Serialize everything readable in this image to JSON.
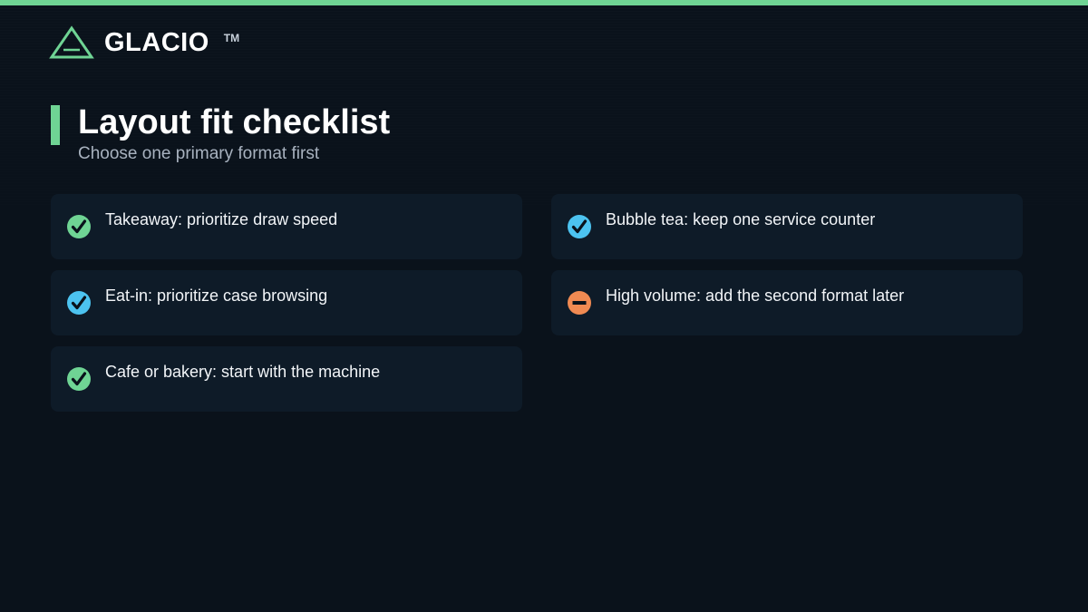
{
  "brand": {
    "name": "GLACIO",
    "trademark": "TM",
    "accent_color": "#6fd494"
  },
  "heading": {
    "title": "Layout fit checklist",
    "subtitle": "Choose one primary format first"
  },
  "checklist": {
    "items": [
      {
        "label": "Takeaway: prioritize draw speed",
        "status": "check",
        "icon": "check-circle-icon",
        "color": "#6fd494"
      },
      {
        "label": "Eat-in: prioritize case browsing",
        "status": "check",
        "icon": "check-circle-icon",
        "color": "#4cc3f0"
      },
      {
        "label": "Cafe or bakery: start with the machine",
        "status": "check",
        "icon": "check-circle-icon",
        "color": "#6fd494"
      },
      {
        "label": "Bubble tea: keep one service counter",
        "status": "check",
        "icon": "check-circle-icon",
        "color": "#4cc3f0"
      },
      {
        "label": "High volume: add the second format later",
        "status": "minus",
        "icon": "minus-circle-icon",
        "color": "#f08a52"
      }
    ]
  },
  "colors": {
    "background": "#0a121b",
    "card_background": "#0e1b28",
    "green": "#6fd494",
    "blue": "#4cc3f0",
    "orange": "#f08a52"
  }
}
